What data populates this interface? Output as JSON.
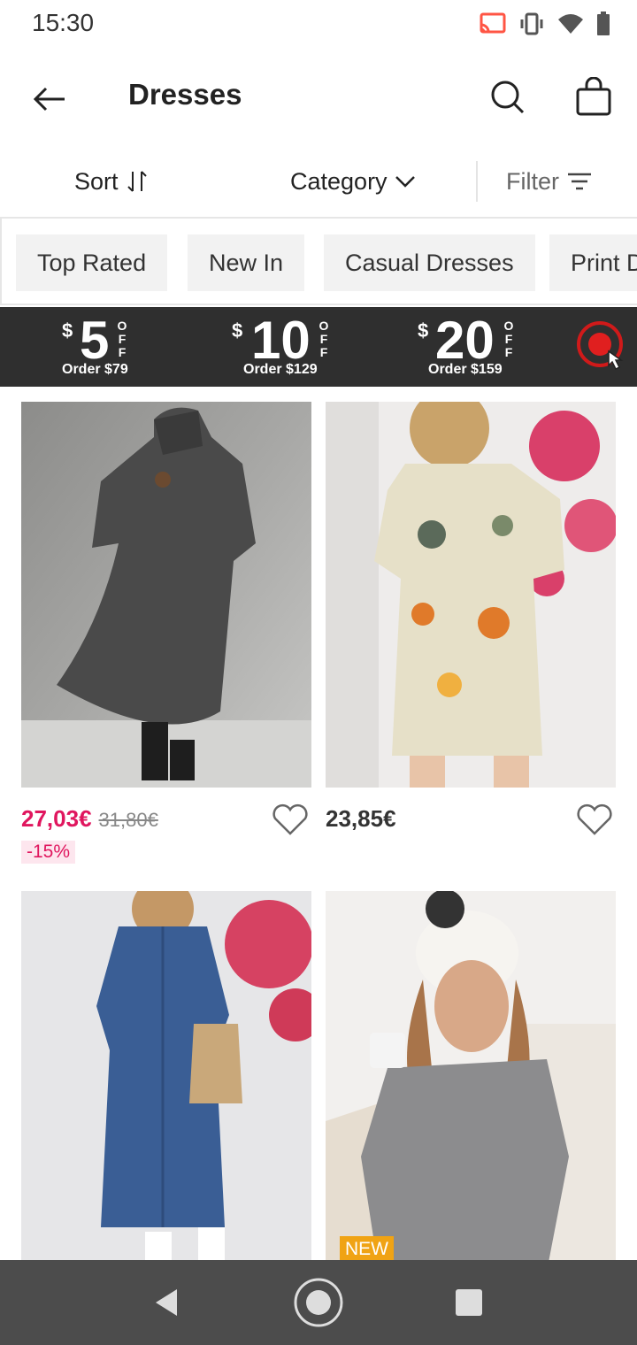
{
  "status": {
    "time": "15:30"
  },
  "header": {
    "title": "Dresses"
  },
  "controls": {
    "sort": "Sort",
    "category": "Category",
    "filter": "Filter"
  },
  "chips": [
    "Top Rated",
    "New In",
    "Casual Dresses",
    "Print Dresses"
  ],
  "promo": {
    "coupons": [
      {
        "currency": "$",
        "amount": "5",
        "off": "OFF",
        "order": "Order $79"
      },
      {
        "currency": "$",
        "amount": "10",
        "off": "OFF",
        "order": "Order $129"
      },
      {
        "currency": "$",
        "amount": "20",
        "off": "OFF",
        "order": "Order $159"
      }
    ]
  },
  "products": [
    {
      "price": "27,03€",
      "old_price": "31,80€",
      "discount": "-15%",
      "badge": ""
    },
    {
      "price": "23,85€",
      "old_price": "",
      "discount": "",
      "badge": ""
    },
    {
      "price": "",
      "old_price": "",
      "discount": "",
      "badge": ""
    },
    {
      "price": "",
      "old_price": "",
      "discount": "",
      "badge": "NEW"
    }
  ],
  "colors": {
    "sale": "#e0165e",
    "promo_bg": "#2f2f2f",
    "badge_new": "#f0a314",
    "nav_bg": "#4c4c4c"
  }
}
